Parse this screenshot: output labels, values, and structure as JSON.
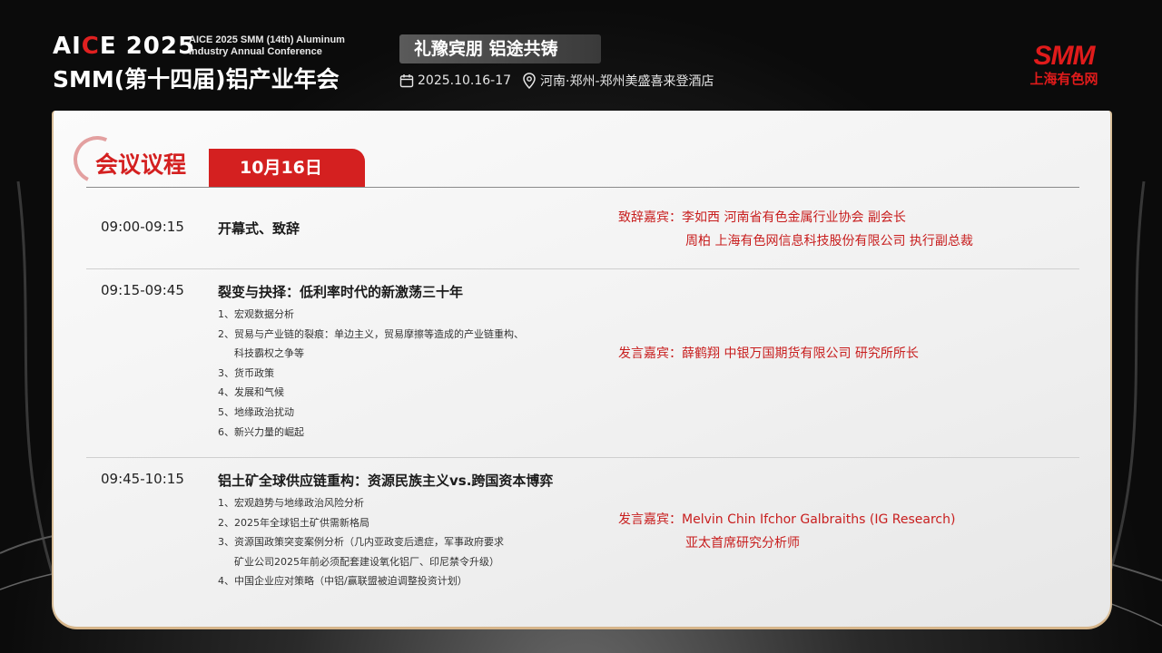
{
  "header": {
    "logo_main": "AICE 2025",
    "logo_sub_line1": "AICE 2025 SMM (14th) Aluminum",
    "logo_sub_line2": "Industry Annual Conference",
    "conference_title": "SMM(第十四届)铝产业年会",
    "slogan": "礼豫宾朋 铝途共铸",
    "date": "2025.10.16-17",
    "location": "河南·郑州-郑州美盛喜来登酒店",
    "brand": {
      "mark": "SMM",
      "name": "上海有色网"
    }
  },
  "agenda": {
    "section_title": "会议议程",
    "date_tab": "10月16日",
    "sessions": [
      {
        "time": "09:00-09:15",
        "topic": "开幕式、致辞",
        "items": [],
        "speaker_lines": [
          "致辞嘉宾：李如西  河南省有色金属行业协会  副会长",
          "周柏 上海有色网信息科技股份有限公司 执行副总裁"
        ]
      },
      {
        "time": "09:15-09:45",
        "topic": "裂变与抉择：低利率时代的新激荡三十年",
        "items": [
          "1、宏观数据分析",
          "2、贸易与产业链的裂痕：单边主义，贸易摩擦等造成的产业链重构、",
          "科技霸权之争等",
          "3、货币政策",
          "4、发展和气候",
          "5、地缘政治扰动",
          "6、新兴力量的崛起"
        ],
        "speaker_lines": [
          "发言嘉宾：薛鹤翔 中银万国期货有限公司 研究所所长"
        ]
      },
      {
        "time": "09:45-10:15",
        "topic": "铝土矿全球供应链重构：资源民族主义vs.跨国资本博弈",
        "items": [
          "1、宏观趋势与地缘政治风险分析",
          "2、2025年全球铝土矿供需新格局",
          "3、资源国政策突变案例分析（几内亚政变后遗症，军事政府要求",
          "矿业公司2025年前必须配套建设氧化铝厂、印尼禁令升级）",
          "4、中国企业应对策略（中铝/赢联盟被迫调整投资计划）"
        ],
        "speaker_lines": [
          "发言嘉宾：Melvin Chin  Ifchor Galbraiths (IG Research)",
          "亚太首席研究分析师"
        ]
      }
    ]
  },
  "colors": {
    "accent": "#d42020",
    "gold": "#d6b58a"
  }
}
